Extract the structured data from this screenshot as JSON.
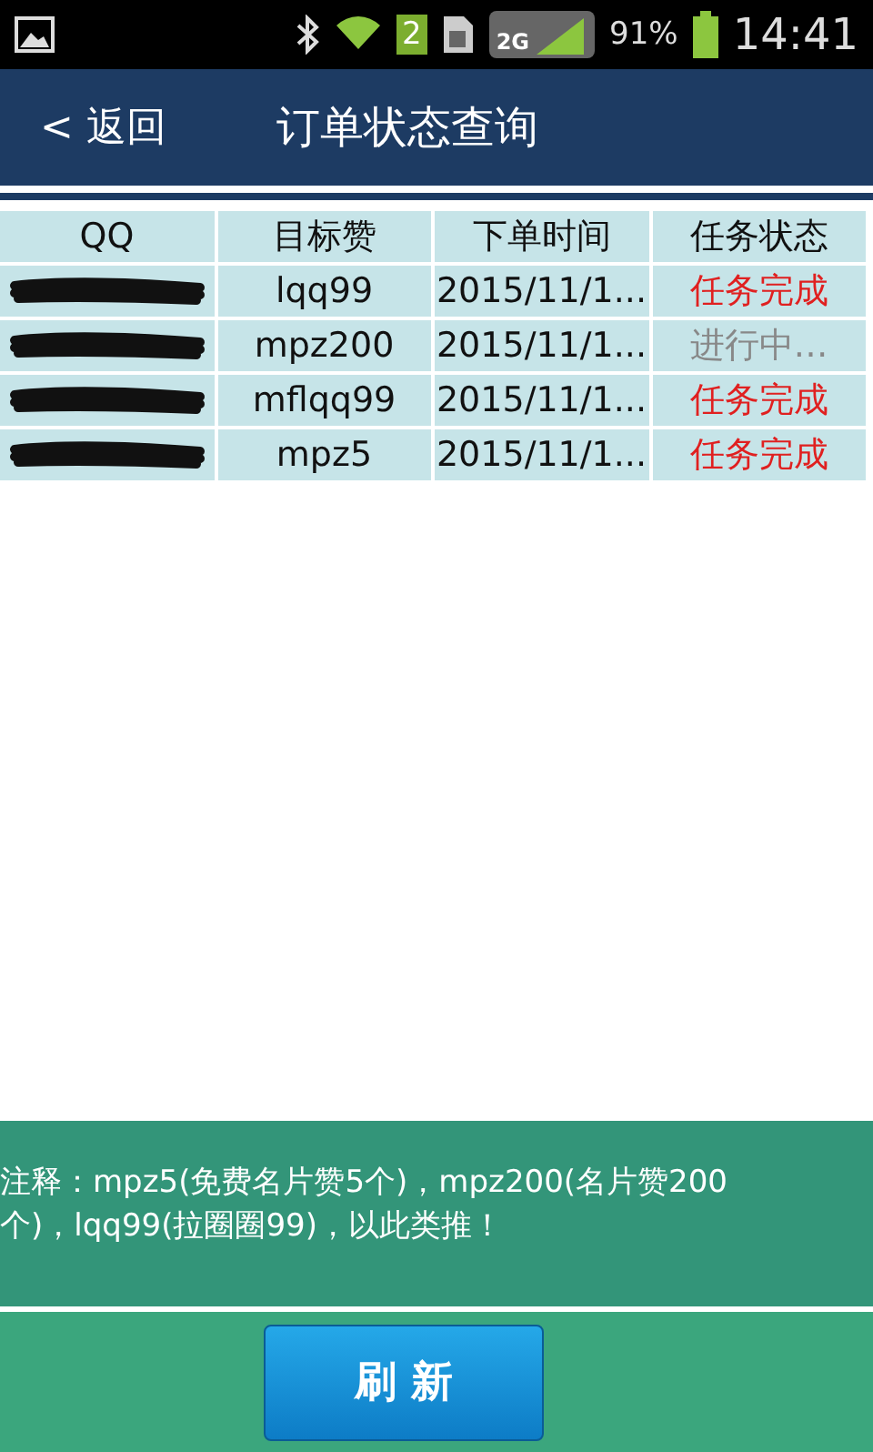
{
  "status_bar": {
    "sim_slot": "2",
    "network": "2G",
    "battery": "91%",
    "time": "14:41"
  },
  "header": {
    "back": "< 返回",
    "title": "订单状态查询"
  },
  "table": {
    "columns": [
      "QQ",
      "目标赞",
      "下单时间",
      "任务状态"
    ],
    "rows": [
      {
        "qq_redacted": true,
        "target": "lqq99",
        "time": "2015/11/1...",
        "status": "任务完成",
        "kind": "done"
      },
      {
        "qq_redacted": true,
        "target": "mpz200",
        "time": "2015/11/1...",
        "status": "进行中…",
        "kind": "pending"
      },
      {
        "qq_redacted": true,
        "target": "mflqq99",
        "time": "2015/11/1...",
        "status": "任务完成",
        "kind": "done"
      },
      {
        "qq_redacted": true,
        "target": "mpz5",
        "time": "2015/11/1...",
        "status": "任务完成",
        "kind": "done"
      }
    ]
  },
  "note": "注释：mpz5(免费名片赞5个)，mpz200(名片赞200个)，lqq99(拉圈圈99)，以此类推！",
  "refresh_button": "刷 新"
}
